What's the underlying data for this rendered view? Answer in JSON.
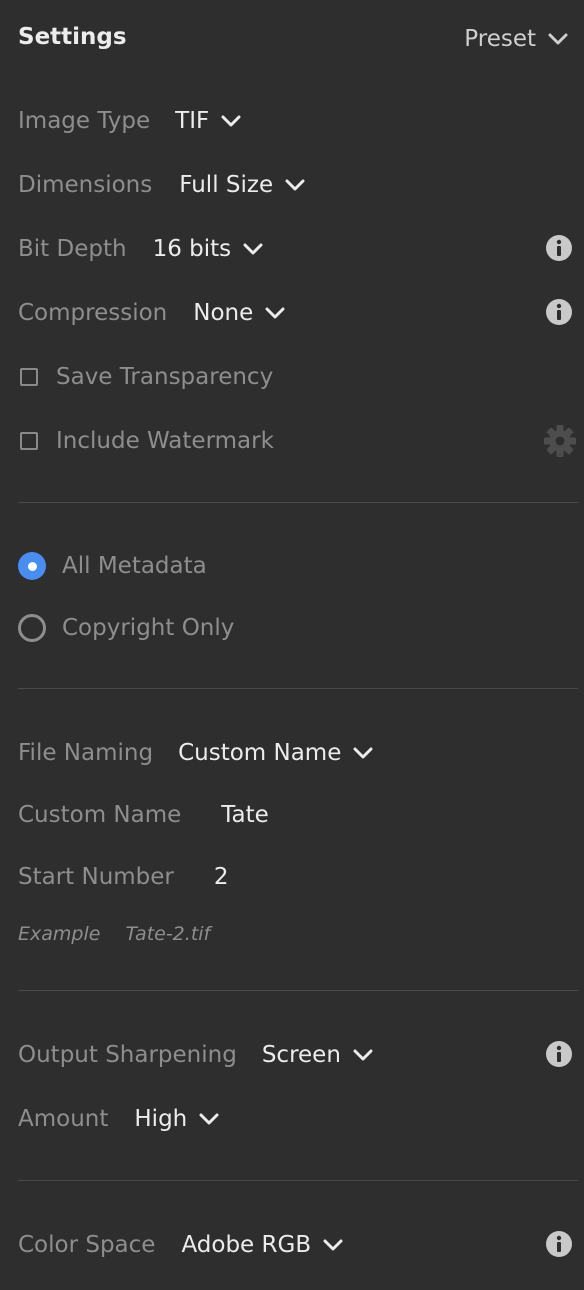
{
  "header": {
    "title": "Settings",
    "preset_label": "Preset"
  },
  "image": {
    "image_type_label": "Image Type",
    "image_type_value": "TIF",
    "dimensions_label": "Dimensions",
    "dimensions_value": "Full Size",
    "bit_depth_label": "Bit Depth",
    "bit_depth_value": "16 bits",
    "compression_label": "Compression",
    "compression_value": "None",
    "save_transparency_label": "Save Transparency",
    "save_transparency_checked": false,
    "include_watermark_label": "Include Watermark",
    "include_watermark_checked": false
  },
  "metadata": {
    "options": [
      {
        "label": "All Metadata",
        "selected": true
      },
      {
        "label": "Copyright Only",
        "selected": false
      }
    ]
  },
  "naming": {
    "file_naming_label": "File Naming",
    "file_naming_value": "Custom Name",
    "custom_name_label": "Custom Name",
    "custom_name_value": "Tate",
    "start_number_label": "Start Number",
    "start_number_value": "2",
    "example_label": "Example",
    "example_value": "Tate-2.tif"
  },
  "sharpening": {
    "output_label": "Output Sharpening",
    "output_value": "Screen",
    "amount_label": "Amount",
    "amount_value": "High"
  },
  "color": {
    "color_space_label": "Color Space",
    "color_space_value": "Adobe RGB"
  },
  "icons": {
    "dropdown": "chevron-down-icon",
    "info": "info-icon",
    "settings": "gear-icon"
  },
  "colors": {
    "background": "#2e2e2e",
    "accent": "#4a8df0",
    "text_primary": "#ececec",
    "text_secondary": "#8e8e8e"
  }
}
